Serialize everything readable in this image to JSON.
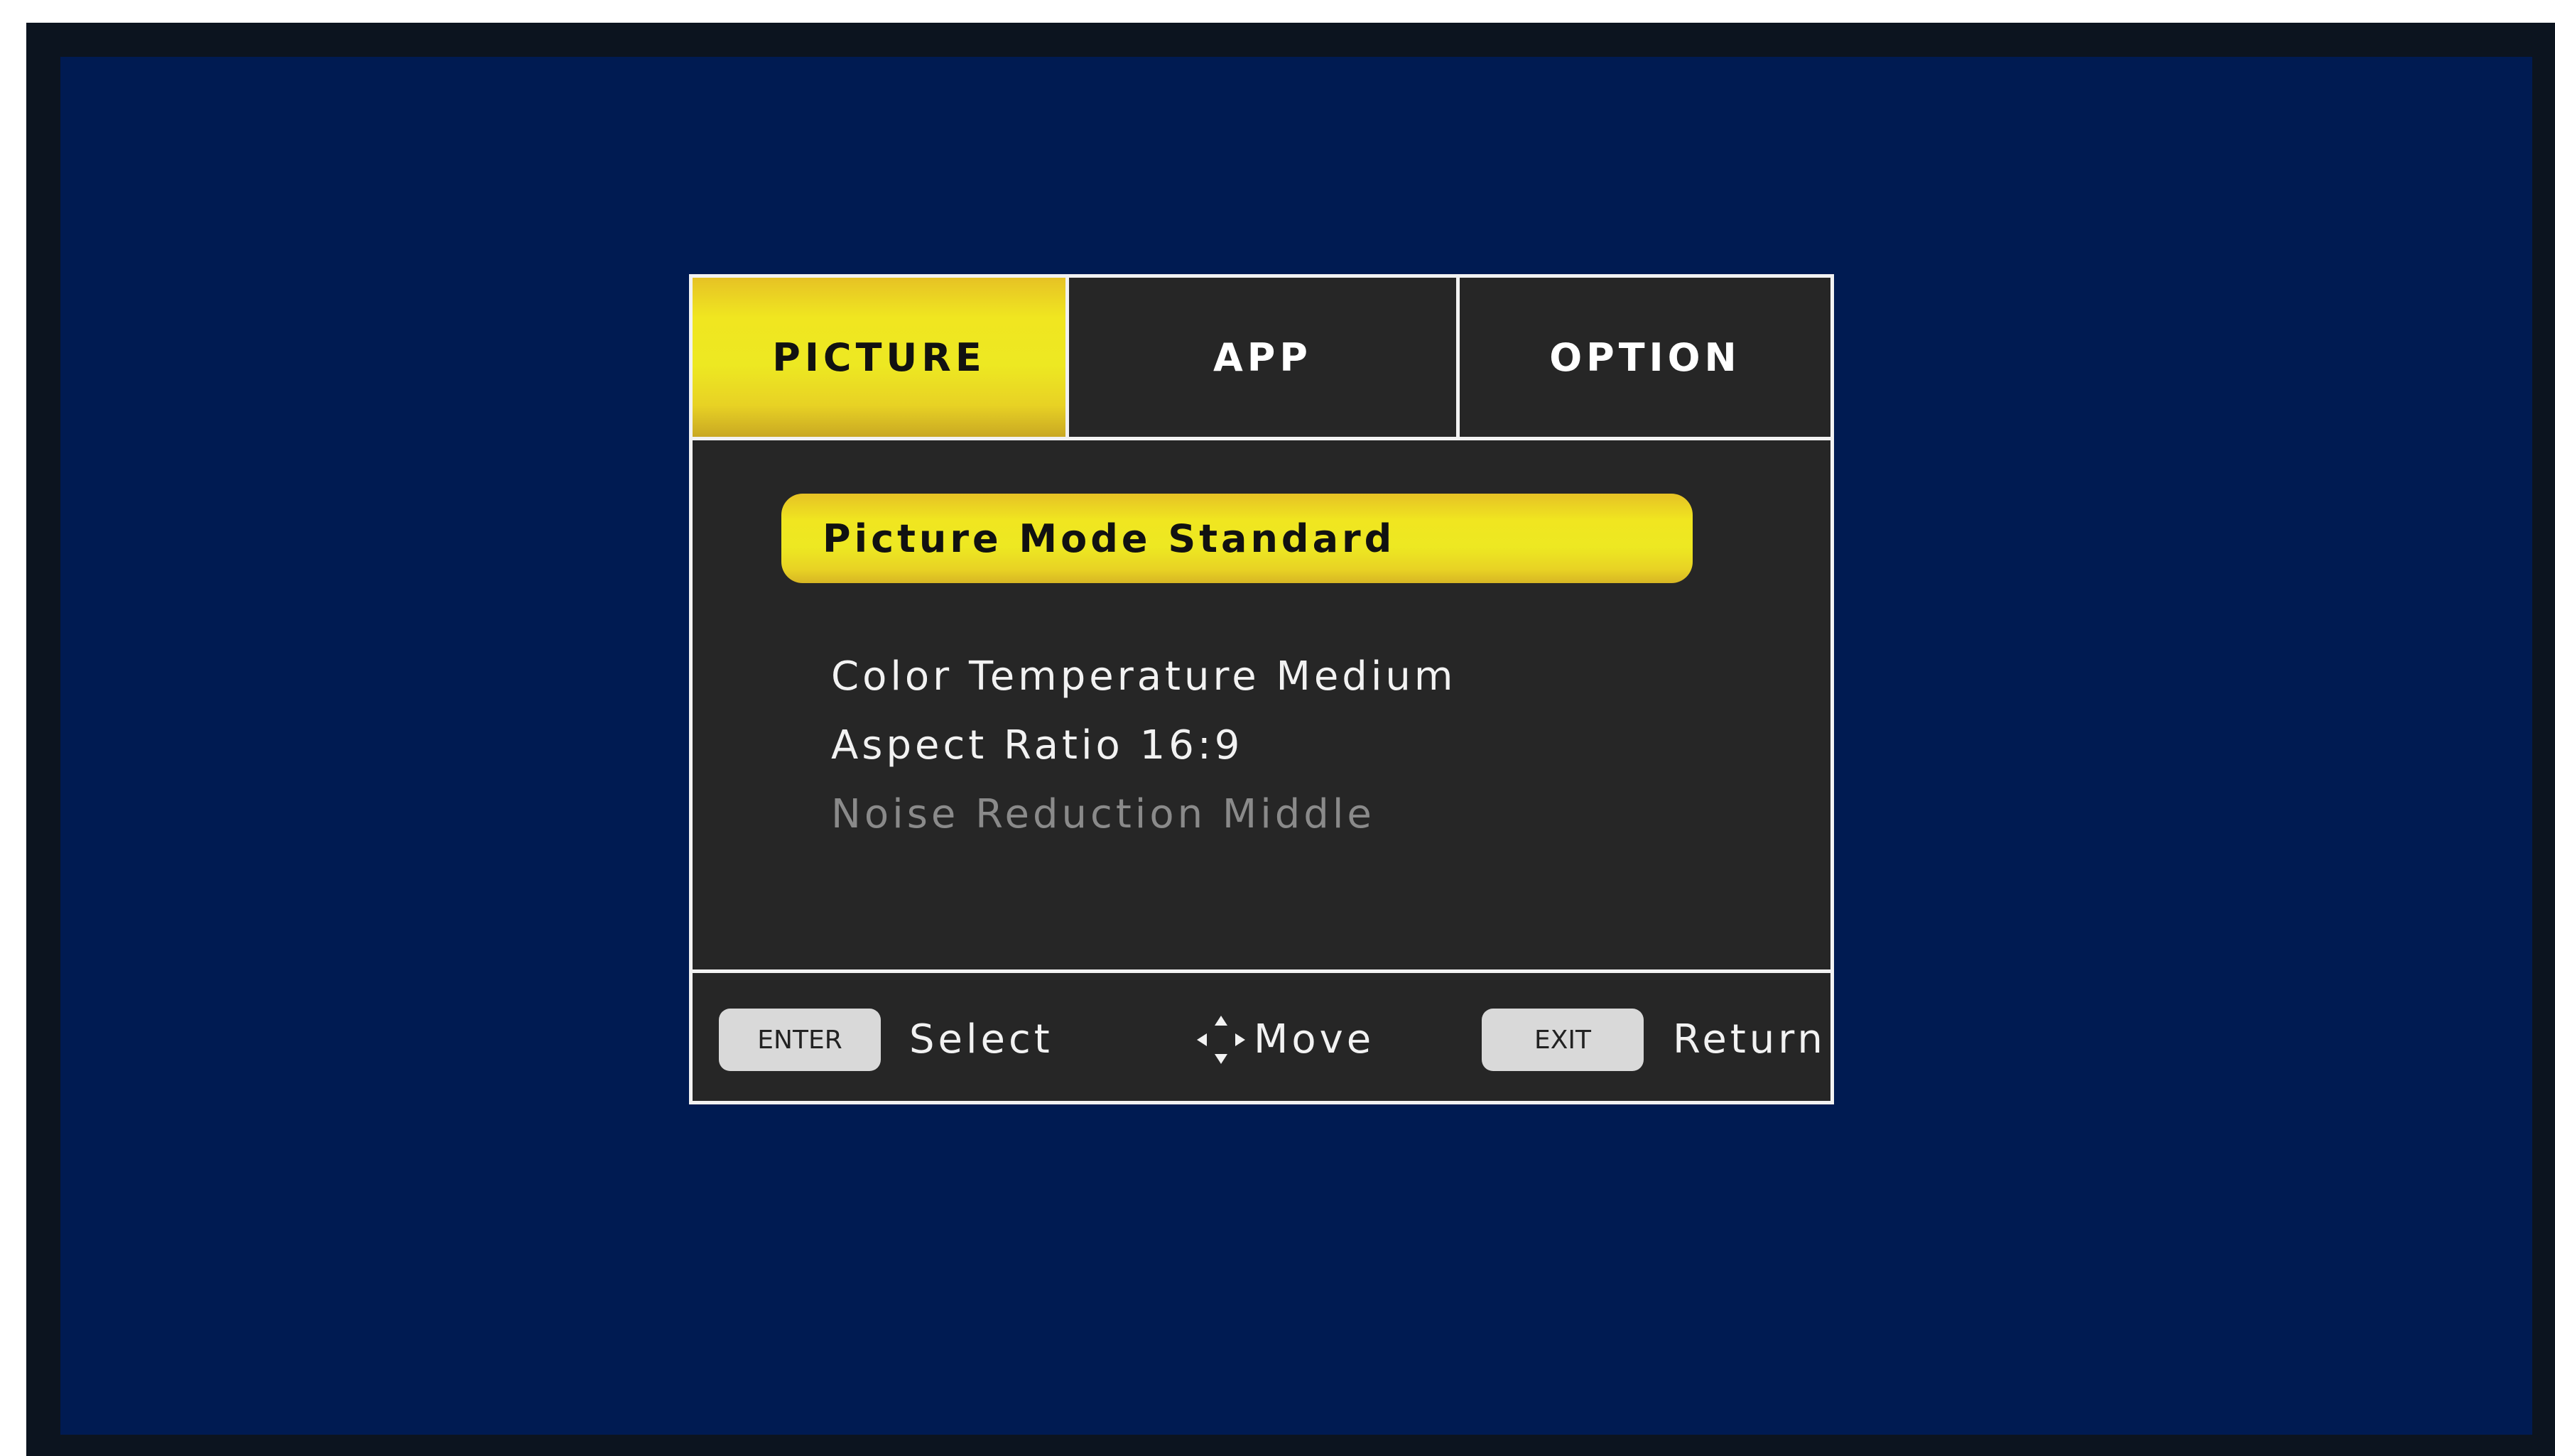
{
  "tabs": [
    {
      "label": "PICTURE",
      "active": true
    },
    {
      "label": "APP",
      "active": false
    },
    {
      "label": "OPTION",
      "active": false
    }
  ],
  "menu": {
    "items": [
      {
        "label": "Picture Mode Standard",
        "selected": true
      },
      {
        "label": "Color Temperature Medium",
        "selected": false
      },
      {
        "label": "Aspect Ratio 16:9",
        "selected": false
      },
      {
        "label": "Noise Reduction Middle",
        "selected": false,
        "disabled": true
      }
    ]
  },
  "footer": {
    "enter_key": "ENTER",
    "enter_action": "Select",
    "move_icon": "four-way-arrows-icon",
    "move_action": "Move",
    "exit_key": "EXIT",
    "exit_action": "Return"
  },
  "colors": {
    "background": "#001b52",
    "bezel": "#0c141f",
    "panel": "#262626",
    "highlight": "#ede822",
    "text": "#f2f2f2",
    "disabled_text": "#8a8a8a"
  }
}
